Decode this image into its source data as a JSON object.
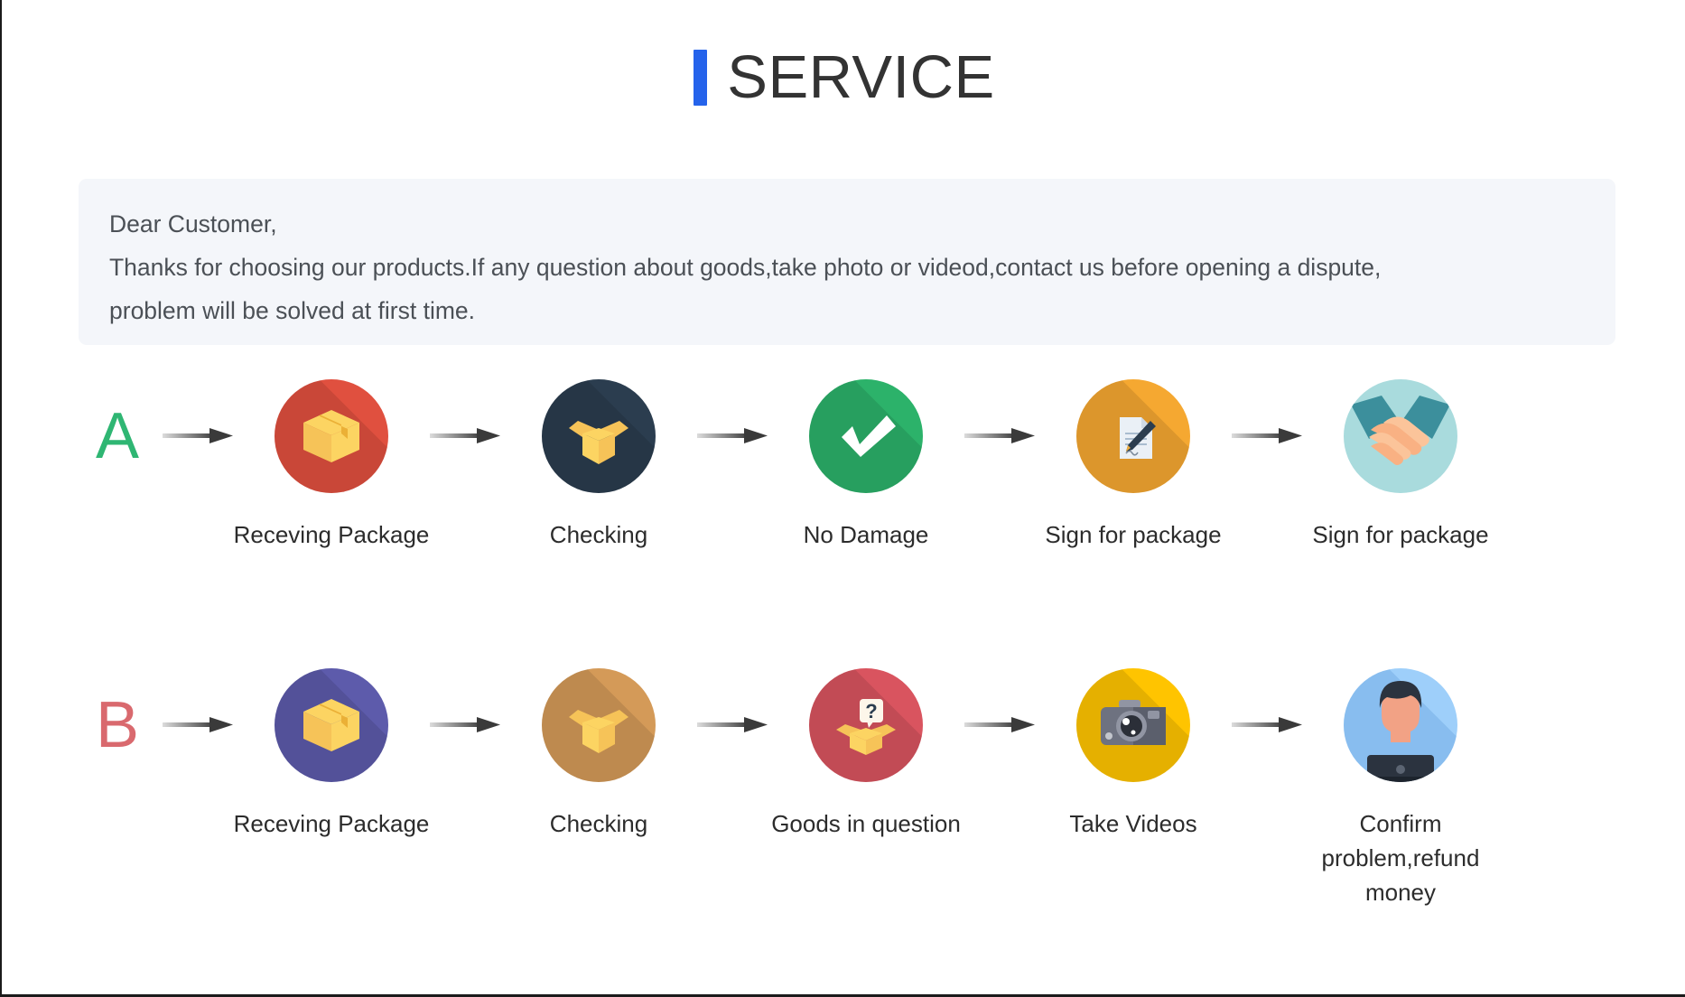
{
  "header": {
    "title": "SERVICE",
    "accent_color": "#2563eb"
  },
  "notice": {
    "line1": "Dear Customer,",
    "line2": "Thanks for choosing our products.If any question about goods,take photo or videod,contact us before opening a dispute,",
    "line3": "problem will be solved at first time.",
    "background_color": "#f4f6fa"
  },
  "flows": [
    {
      "letter": "A",
      "letter_color": "#2fb673",
      "steps": [
        {
          "label": "Receving Package",
          "icon": "package-box-icon",
          "circle_color": "#e0503f"
        },
        {
          "label": "Checking",
          "icon": "open-box-icon",
          "circle_color": "#2b3d4f"
        },
        {
          "label": "No Damage",
          "icon": "check-mark-icon",
          "circle_color": "#2cb26a"
        },
        {
          "label": "Sign for package",
          "icon": "document-pen-icon",
          "circle_color": "#f5a831"
        },
        {
          "label": "Sign for package",
          "icon": "handshake-icon",
          "circle_color": "#a9dbdd"
        }
      ]
    },
    {
      "letter": "B",
      "letter_color": "#d9696e",
      "steps": [
        {
          "label": "Receving Package",
          "icon": "package-box-icon",
          "circle_color": "#5d5bab"
        },
        {
          "label": "Checking",
          "icon": "open-box-icon",
          "circle_color": "#d49a58"
        },
        {
          "label": "Goods in question",
          "icon": "question-box-icon",
          "circle_color": "#d9545f"
        },
        {
          "label": "Take Videos",
          "icon": "camera-icon",
          "circle_color": "#ffc400"
        },
        {
          "label": "Confirm problem,refund money",
          "icon": "support-agent-icon",
          "circle_color": "#9ecffa"
        }
      ]
    }
  ],
  "arrow": {
    "icon": "right-arrow-icon"
  }
}
